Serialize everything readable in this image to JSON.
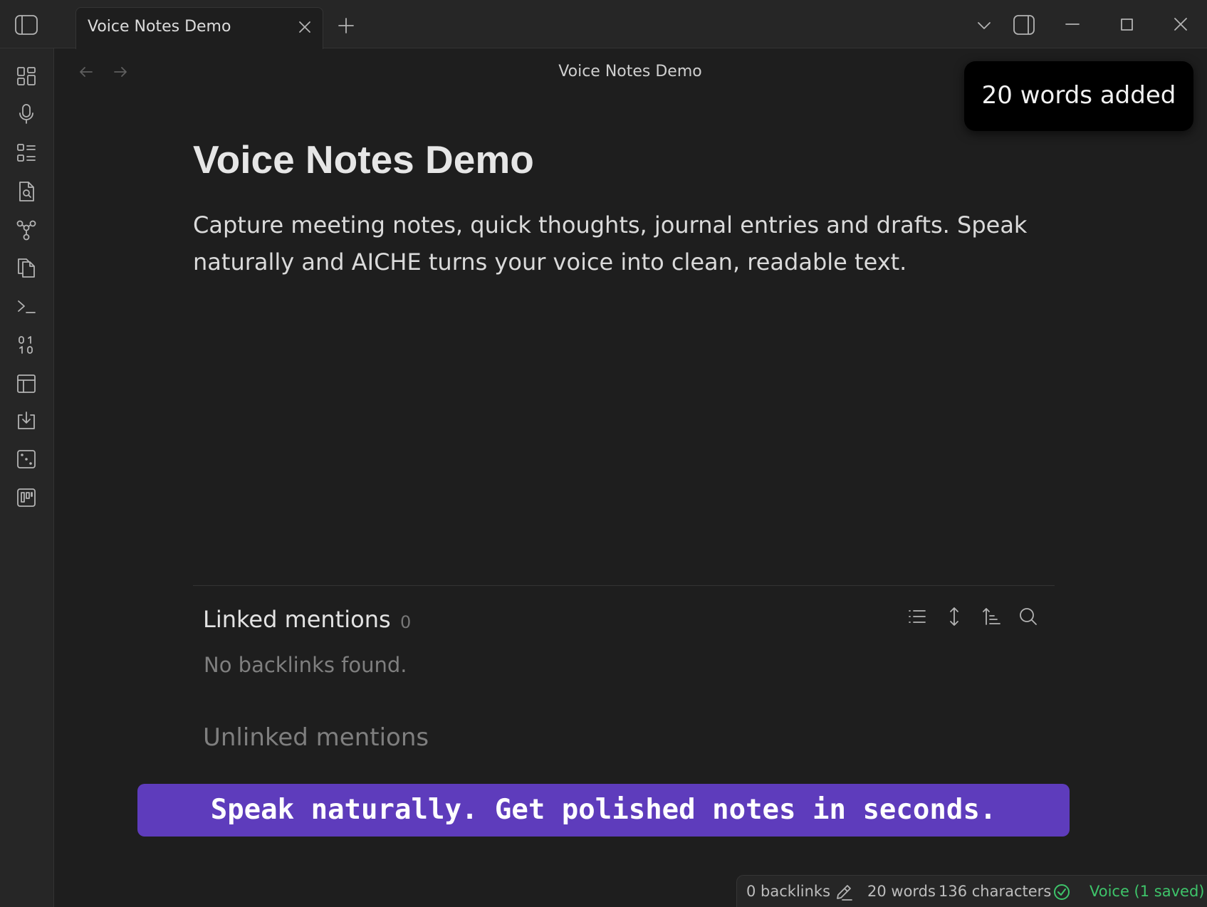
{
  "window": {
    "tab_title": "Voice Notes Demo",
    "controls": {
      "minimize": "minimize-icon",
      "maximize": "maximize-icon",
      "close": "close-icon"
    }
  },
  "ribbon": {
    "icons": [
      "grid-icon",
      "microphone-icon",
      "list-grid-icon",
      "search-file-icon",
      "graph-icon",
      "copy-icon",
      "terminal-icon",
      "binary-icon",
      "layout-icon",
      "download-icon",
      "dice-icon",
      "kanban-icon"
    ]
  },
  "header": {
    "title": "Voice Notes Demo"
  },
  "toast": {
    "text": "20 words added"
  },
  "note": {
    "title": "Voice Notes Demo",
    "body": "Capture meeting notes, quick thoughts, journal entries and drafts. Speak naturally and AICHE turns your voice into clean, readable text."
  },
  "mentions": {
    "linked_title": "Linked mentions",
    "linked_count": "0",
    "empty_text": "No backlinks found.",
    "unlinked_title": "Unlinked mentions"
  },
  "banner": {
    "text": "Speak naturally. Get polished notes in seconds."
  },
  "statusbar": {
    "backlinks": "0 backlinks",
    "words": "20 words",
    "characters": "136 characters",
    "voice": "Voice (1 saved)"
  },
  "colors": {
    "accent": "#5e3cbc",
    "success": "#3ec46a",
    "background": "#1e1e1e"
  }
}
